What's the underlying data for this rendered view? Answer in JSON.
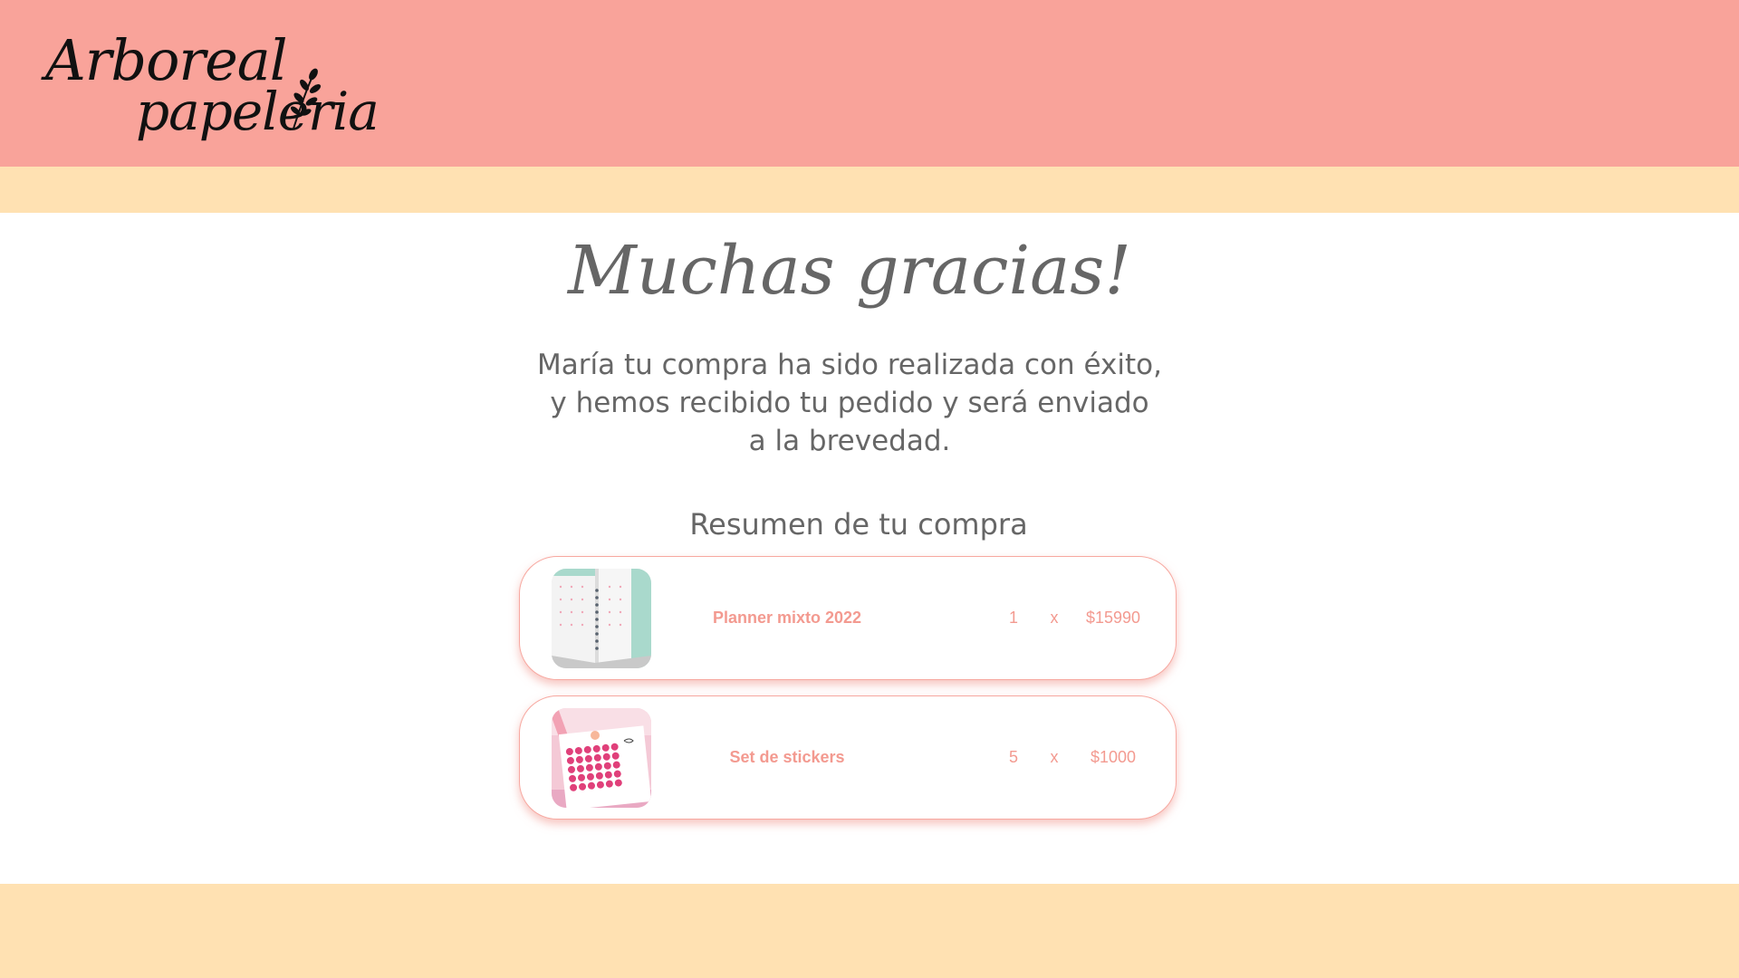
{
  "brand": {
    "line1": "Arboreal",
    "line2": "papeleria"
  },
  "colors": {
    "header": "#f9a39a",
    "stripe": "#ffe1b2",
    "accent_text": "#f39a90",
    "body_text": "#666666"
  },
  "thanks_title": "Muchas gracias!",
  "message": {
    "line1": "María tu compra ha sido realizada con éxito,",
    "line2": "y hemos recibido tu pedido y será enviado",
    "line3": "a la brevedad."
  },
  "summary": {
    "title": "Resumen de tu compra",
    "items": [
      {
        "name": "Planner mixto 2022",
        "quantity": "1",
        "times": "x",
        "price": "$15990",
        "image_icon": "planner-image"
      },
      {
        "name": "Set de stickers",
        "quantity": "5",
        "times": "x",
        "price": "$1000",
        "image_icon": "stickers-image"
      }
    ]
  }
}
